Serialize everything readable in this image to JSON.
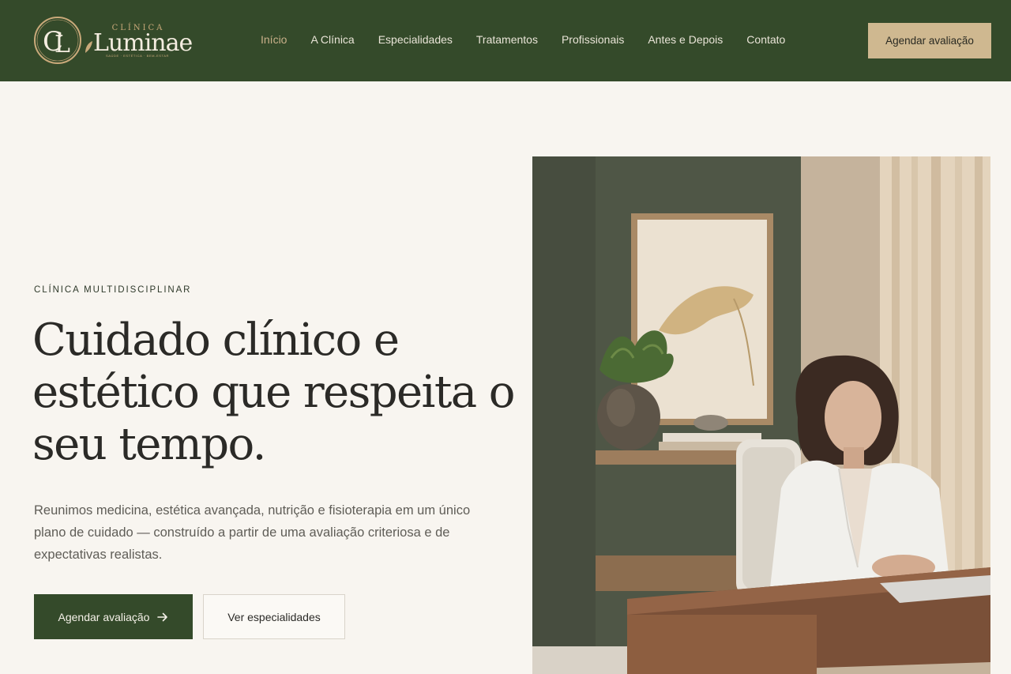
{
  "brand": {
    "monogram": "CL",
    "small_label": "CLÍNICA",
    "name": "Luminae",
    "tagline": "SAÚDE · ESTÉTICA · BEM-ESTAR"
  },
  "nav": {
    "items": [
      {
        "label": "Início",
        "active": true
      },
      {
        "label": "A Clínica"
      },
      {
        "label": "Especialidades"
      },
      {
        "label": "Tratamentos"
      },
      {
        "label": "Profissionais"
      },
      {
        "label": "Antes e Depois"
      },
      {
        "label": "Contato"
      }
    ],
    "cta": "Agendar avaliação"
  },
  "hero": {
    "eyebrow": "CLÍNICA MULTIDISCIPLINAR",
    "headline_1": "Cuidado clínico e",
    "headline_2": "estético que respeita o",
    "headline_3": "seu tempo.",
    "lead": "Reunimos medicina, estética avançada, nutrição e fisioterapia em um único plano de cuidado — construído a partir de uma avaliação criteriosa e de expectativas realistas.",
    "primary_cta": "Agendar avaliação",
    "primary_cta_icon": "arrow-right-icon",
    "secondary_cta": "Ver especialidades"
  },
  "colors": {
    "header_bg": "#344a2a",
    "accent_gold": "#cfb890",
    "page_bg": "#f8f5f0"
  }
}
